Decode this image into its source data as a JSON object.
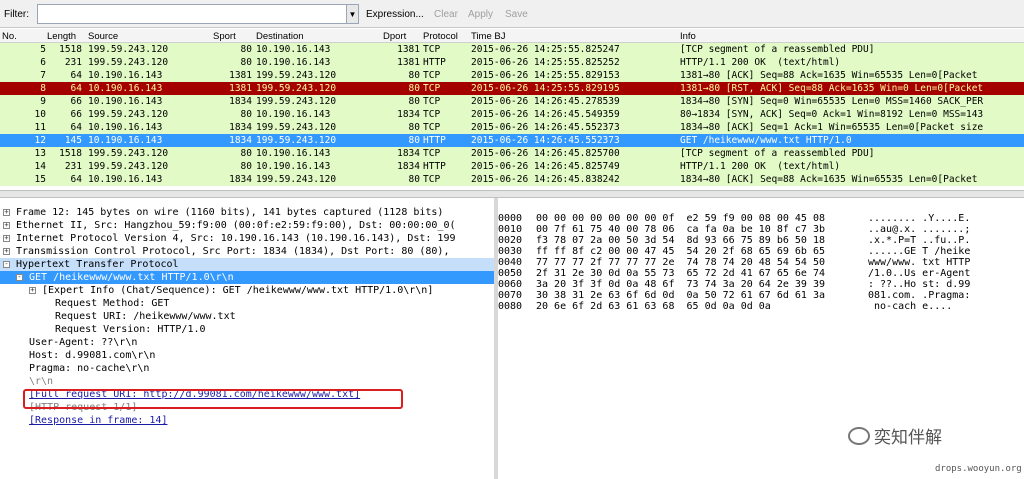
{
  "filter": {
    "label": "Filter:",
    "value": "",
    "expression": "Expression...",
    "clear": "Clear",
    "apply": "Apply",
    "save": "Save"
  },
  "columns": [
    "No.",
    "Length",
    "Source",
    "Sport",
    "Destination",
    "Dport",
    "Protocol",
    "Time BJ",
    "Info"
  ],
  "packets": [
    {
      "no": "5",
      "len": "1518",
      "src": "199.59.243.120",
      "sport": "80",
      "dst": "10.190.16.143",
      "dport": "1381",
      "proto": "TCP",
      "time": "2015-06-26 14:25:55.825247",
      "info": "[TCP segment of a reassembled PDU]",
      "style": "green"
    },
    {
      "no": "6",
      "len": "231",
      "src": "199.59.243.120",
      "sport": "80",
      "dst": "10.190.16.143",
      "dport": "1381",
      "proto": "HTTP",
      "time": "2015-06-26 14:25:55.825252",
      "info": "HTTP/1.1 200 OK  (text/html)",
      "style": "green"
    },
    {
      "no": "7",
      "len": "64",
      "src": "10.190.16.143",
      "sport": "1381",
      "dst": "199.59.243.120",
      "dport": "80",
      "proto": "TCP",
      "time": "2015-06-26 14:25:55.829153",
      "info": "1381→80 [ACK] Seq=88 Ack=1635 Win=65535 Len=0[Packet",
      "style": "green"
    },
    {
      "no": "8",
      "len": "64",
      "src": "10.190.16.143",
      "sport": "1381",
      "dst": "199.59.243.120",
      "dport": "80",
      "proto": "TCP",
      "time": "2015-06-26 14:25:55.829195",
      "info": "1381→80 [RST, ACK] Seq=88 Ack=1635 Win=0 Len=0[Packet",
      "style": "red"
    },
    {
      "no": "9",
      "len": "66",
      "src": "10.190.16.143",
      "sport": "1834",
      "dst": "199.59.243.120",
      "dport": "80",
      "proto": "TCP",
      "time": "2015-06-26 14:26:45.278539",
      "info": "1834→80 [SYN] Seq=0 Win=65535 Len=0 MSS=1460 SACK_PER",
      "style": "green"
    },
    {
      "no": "10",
      "len": "66",
      "src": "199.59.243.120",
      "sport": "80",
      "dst": "10.190.16.143",
      "dport": "1834",
      "proto": "TCP",
      "time": "2015-06-26 14:26:45.549359",
      "info": "80→1834 [SYN, ACK] Seq=0 Ack=1 Win=8192 Len=0 MSS=143",
      "style": "green"
    },
    {
      "no": "11",
      "len": "64",
      "src": "10.190.16.143",
      "sport": "1834",
      "dst": "199.59.243.120",
      "dport": "80",
      "proto": "TCP",
      "time": "2015-06-26 14:26:45.552373",
      "info": "1834→80 [ACK] Seq=1 Ack=1 Win=65535 Len=0[Packet size",
      "style": "green"
    },
    {
      "no": "12",
      "len": "145",
      "src": "10.190.16.143",
      "sport": "1834",
      "dst": "199.59.243.120",
      "dport": "80",
      "proto": "HTTP",
      "time": "2015-06-26 14:26:45.552373",
      "info": "GET /heikewww/www.txt HTTP/1.0",
      "style": "sel"
    },
    {
      "no": "13",
      "len": "1518",
      "src": "199.59.243.120",
      "sport": "80",
      "dst": "10.190.16.143",
      "dport": "1834",
      "proto": "TCP",
      "time": "2015-06-26 14:26:45.825700",
      "info": "[TCP segment of a reassembled PDU]",
      "style": "green"
    },
    {
      "no": "14",
      "len": "231",
      "src": "199.59.243.120",
      "sport": "80",
      "dst": "10.190.16.143",
      "dport": "1834",
      "proto": "HTTP",
      "time": "2015-06-26 14:26:45.825749",
      "info": "HTTP/1.1 200 OK  (text/html)",
      "style": "green"
    },
    {
      "no": "15",
      "len": "64",
      "src": "10.190.16.143",
      "sport": "1834",
      "dst": "199.59.243.120",
      "dport": "80",
      "proto": "TCP",
      "time": "2015-06-26 14:26:45.838242",
      "info": "1834→80 [ACK] Seq=88 Ack=1635 Win=65535 Len=0[Packet",
      "style": "green"
    }
  ],
  "tree": [
    {
      "text": "Frame 12: 145 bytes on wire (1160 bits), 141 bytes captured (1128 bits)",
      "indent": 0,
      "tog": "+",
      "style": ""
    },
    {
      "text": "Ethernet II, Src: Hangzhou_59:f9:00 (00:0f:e2:59:f9:00), Dst: 00:00:00_0(",
      "indent": 0,
      "tog": "+",
      "style": ""
    },
    {
      "text": "Internet Protocol Version 4, Src: 10.190.16.143 (10.190.16.143), Dst: 199",
      "indent": 0,
      "tog": "+",
      "style": ""
    },
    {
      "text": "Transmission Control Protocol, Src Port: 1834 (1834), Dst Port: 80 (80),",
      "indent": 0,
      "tog": "+",
      "style": ""
    },
    {
      "text": "Hypertext Transfer Protocol",
      "indent": 0,
      "tog": "-",
      "style": "hl"
    },
    {
      "text": "GET /heikewww/www.txt HTTP/1.0\\r\\n",
      "indent": 1,
      "tog": "-",
      "style": "sel"
    },
    {
      "text": "[Expert Info (Chat/Sequence): GET /heikewww/www.txt HTTP/1.0\\r\\n]",
      "indent": 2,
      "tog": "+",
      "style": ""
    },
    {
      "text": "Request Method: GET",
      "indent": 3,
      "tog": "",
      "style": ""
    },
    {
      "text": "Request URI: /heikewww/www.txt",
      "indent": 3,
      "tog": "",
      "style": ""
    },
    {
      "text": "Request Version: HTTP/1.0",
      "indent": 3,
      "tog": "",
      "style": ""
    },
    {
      "text": "User-Agent: ??\\r\\n",
      "indent": 1,
      "tog": "",
      "style": ""
    },
    {
      "text": "Host: d.99081.com\\r\\n",
      "indent": 1,
      "tog": "",
      "style": ""
    },
    {
      "text": "Pragma: no-cache\\r\\n",
      "indent": 1,
      "tog": "",
      "style": ""
    },
    {
      "text": "\\r\\n",
      "indent": 1,
      "tog": "",
      "style": "gray"
    },
    {
      "text": "[Full request URI: http://d.99081.com/heikewww/www.txt]",
      "indent": 1,
      "tog": "",
      "style": "link"
    },
    {
      "text": "[HTTP request 1/1]",
      "indent": 1,
      "tog": "",
      "style": "gray"
    },
    {
      "text": "[Response in frame: 14]",
      "indent": 1,
      "tog": "",
      "style": "link"
    }
  ],
  "hex": [
    {
      "off": "0000",
      "bytes": "00 00 00 00 00 00 00 0f  e2 59 f9 00 08 00 45 08",
      "ascii": "........ .Y....E."
    },
    {
      "off": "0010",
      "bytes": "00 7f 61 75 40 00 78 06  ca fa 0a be 10 8f c7 3b",
      "ascii": "..au@.x. .......;"
    },
    {
      "off": "0020",
      "bytes": "f3 78 07 2a 00 50 3d 54  8d 93 66 75 89 b6 50 18",
      "ascii": ".x.*.P=T ..fu..P."
    },
    {
      "off": "0030",
      "bytes": "ff ff 8f c2 00 00 47 45  54 20 2f 68 65 69 6b 65",
      "ascii": "......GE T /heike"
    },
    {
      "off": "0040",
      "bytes": "77 77 77 2f 77 77 77 2e  74 78 74 20 48 54 54 50",
      "ascii": "www/www. txt HTTP"
    },
    {
      "off": "0050",
      "bytes": "2f 31 2e 30 0d 0a 55 73  65 72 2d 41 67 65 6e 74",
      "ascii": "/1.0..Us er-Agent"
    },
    {
      "off": "0060",
      "bytes": "3a 20 3f 3f 0d 0a 48 6f  73 74 3a 20 64 2e 39 39",
      "ascii": ": ??..Ho st: d.99"
    },
    {
      "off": "0070",
      "bytes": "30 38 31 2e 63 6f 6d 0d  0a 50 72 61 67 6d 61 3a",
      "ascii": "081.com. .Pragma:"
    },
    {
      "off": "0080",
      "bytes": "20 6e 6f 2d 63 61 63 68  65 0d 0a 0d 0a",
      "ascii": " no-cach e...."
    }
  ],
  "watermark": {
    "text": "奕知伴解",
    "url": "drops.wooyun.org"
  },
  "colors": {
    "green_row": "#e2fbc6",
    "red_row": "#a40000",
    "selected": "#3399ff",
    "highlight_box": "#d81e1e"
  }
}
